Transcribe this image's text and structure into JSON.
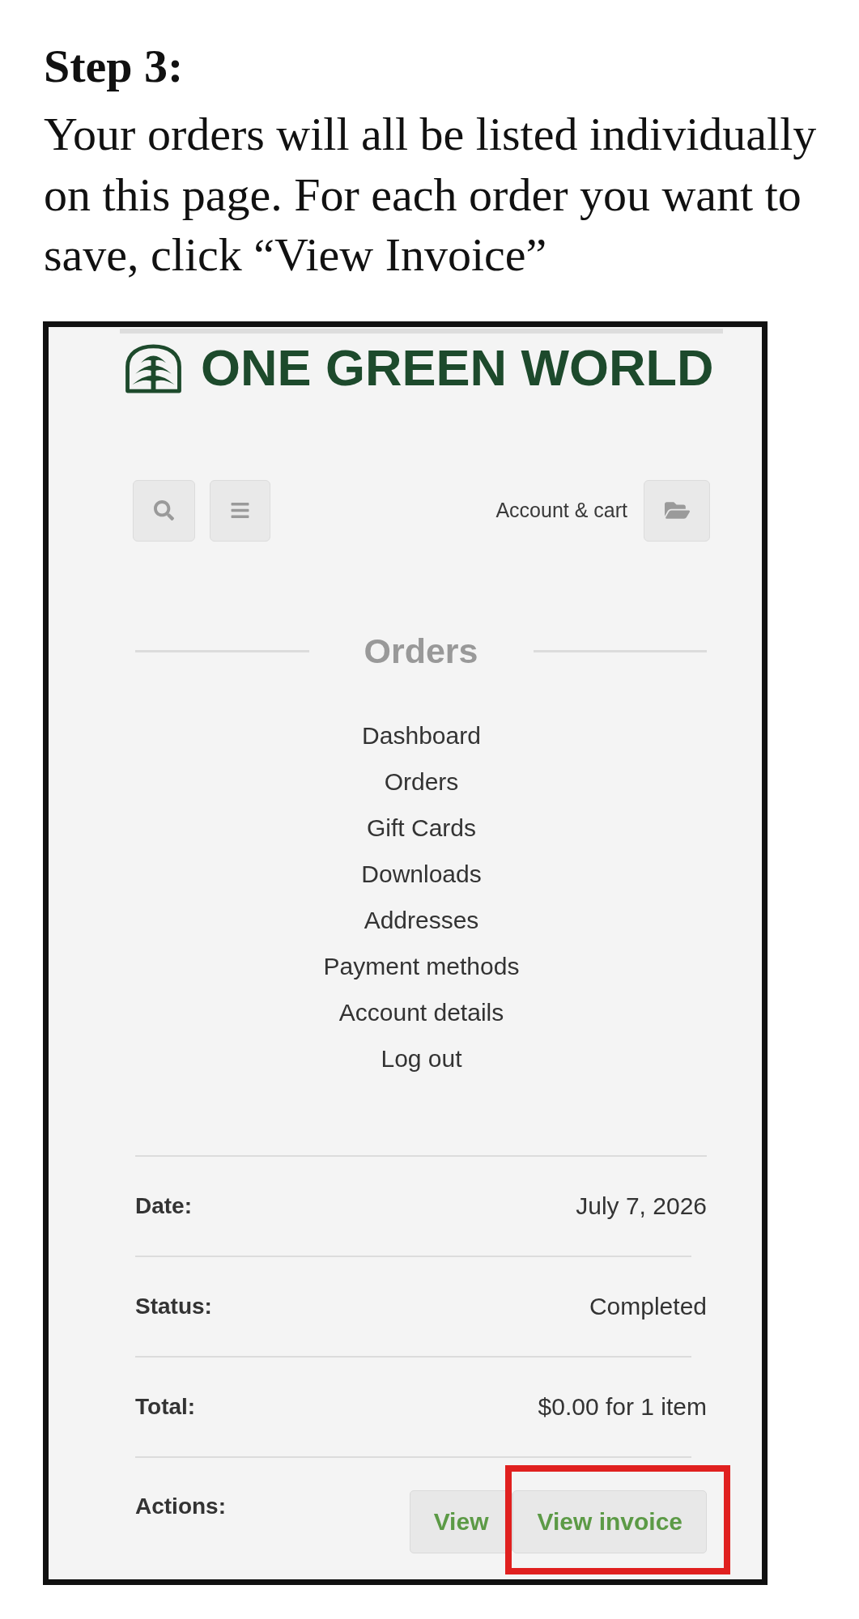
{
  "instruction": {
    "heading": "Step 3:",
    "text": "Your orders will all be listed individually on this page. For each order you want to save, click “View Invoice”"
  },
  "screenshot": {
    "logo": {
      "text": "ONE GREEN WORLD"
    },
    "header": {
      "account_link": "Account & cart"
    },
    "page_title": "Orders",
    "account_menu": [
      "Dashboard",
      "Orders",
      "Gift Cards",
      "Downloads",
      "Addresses",
      "Payment methods",
      "Account details",
      "Log out"
    ],
    "order": {
      "fields": [
        {
          "label": "Date:",
          "value": "July 7, 2026"
        },
        {
          "label": "Status:",
          "value": "Completed"
        },
        {
          "label": "Total:",
          "value": "$0.00 for 1 item"
        }
      ],
      "actions_label": "Actions:",
      "actions": [
        {
          "label": "View",
          "highlighted": false
        },
        {
          "label": "View invoice",
          "highlighted": true
        }
      ]
    }
  }
}
